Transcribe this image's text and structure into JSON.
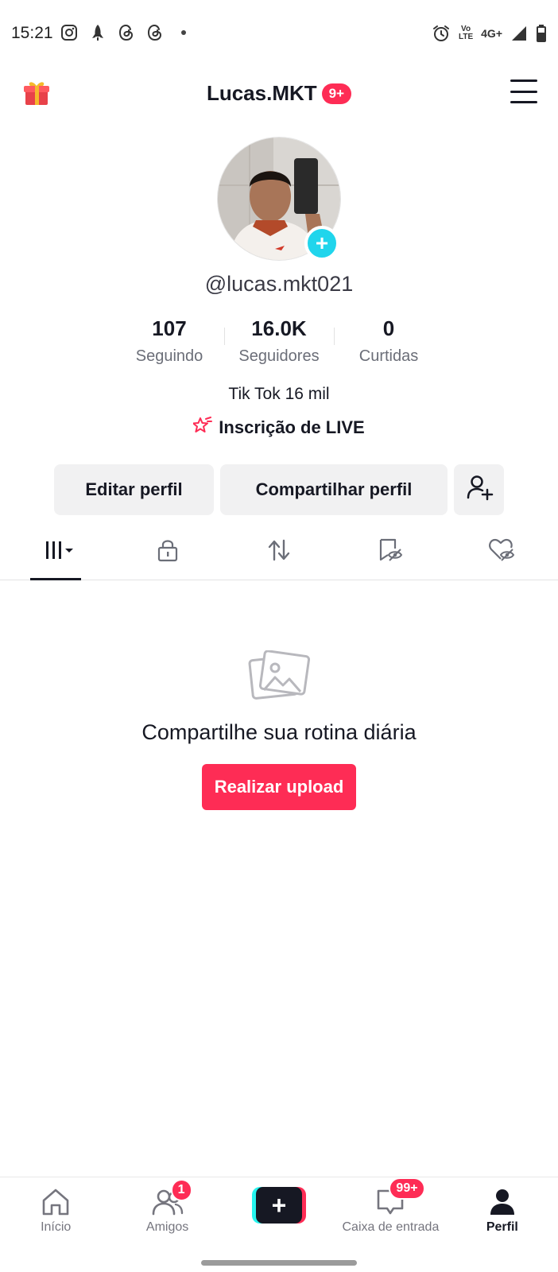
{
  "status_bar": {
    "time": "15:21",
    "left_icons": [
      "instagram-icon",
      "rocket-icon",
      "threads-icon",
      "threads-icon",
      "dot-icon"
    ],
    "right_icons": [
      "alarm-icon",
      "volte-icon",
      "signal-icon",
      "battery-icon"
    ],
    "volte_top": "Vo",
    "volte_bottom": "LTE",
    "network": "4G+"
  },
  "header": {
    "title": "Lucas.MKT",
    "badge": "9+"
  },
  "profile": {
    "username": "@lucas.mkt021",
    "bio": "Tik Tok 16 mil",
    "live_subscription": "Inscrição de LIVE"
  },
  "stats": [
    {
      "value": "107",
      "label": "Seguindo"
    },
    {
      "value": "16.0K",
      "label": "Seguidores"
    },
    {
      "value": "0",
      "label": "Curtidas"
    }
  ],
  "buttons": {
    "edit": "Editar perfil",
    "share": "Compartilhar perfil"
  },
  "tabs": [
    {
      "icon": "grid-icon",
      "active": true
    },
    {
      "icon": "lock-icon",
      "active": false
    },
    {
      "icon": "repost-icon",
      "active": false
    },
    {
      "icon": "bookmark-hidden-icon",
      "active": false
    },
    {
      "icon": "heart-hidden-icon",
      "active": false
    }
  ],
  "empty_state": {
    "title": "Compartilhe sua rotina diária",
    "button": "Realizar upload"
  },
  "bottom_nav": {
    "home": "Início",
    "friends": "Amigos",
    "friends_badge": "1",
    "inbox": "Caixa de entrada",
    "inbox_badge": "99+",
    "profile": "Perfil"
  },
  "colors": {
    "accent": "#fe2c55",
    "cyan": "#25f4ee",
    "text": "#161823",
    "muted": "#6b6e78"
  }
}
